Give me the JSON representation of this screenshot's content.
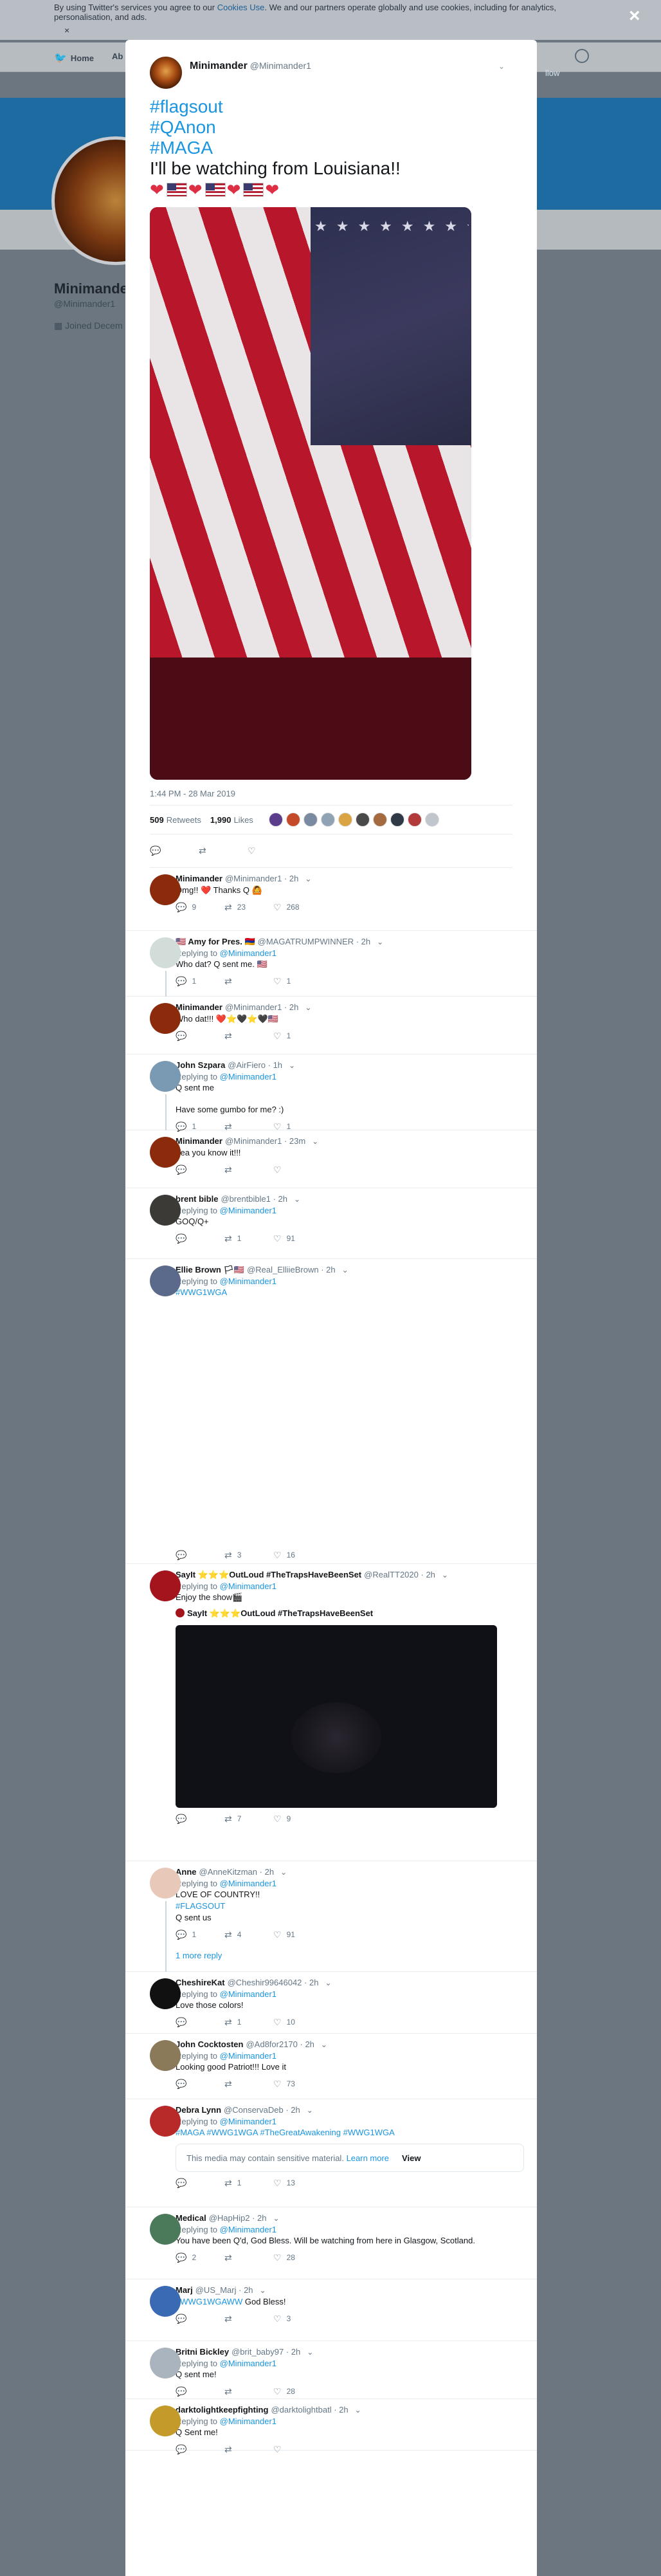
{
  "background": {
    "cookie_text_pre": "By using Twitter's services you agree to our ",
    "cookie_link": "Cookies Use",
    "cookie_text_post": ". We and our partners operate globally and use cookies, including for analytics, personalisation, and ads.",
    "nav_home": "Home",
    "nav_about": "Ab",
    "profile_name": "Minimander",
    "profile_handle": "@Minimander1",
    "profile_joined": "Joined Decem",
    "right_follow": "llow"
  },
  "modal": {
    "close_symbol": "×",
    "main_tweet": {
      "name": "Minimander",
      "handle": "@Minimander1",
      "tags": [
        "#flagsout",
        "#QAnon",
        "#MAGA"
      ],
      "text": "I'll be watching from Louisiana!!",
      "time": "1:44 PM - 28 Mar 2019",
      "retweets_count": "509",
      "retweets_label": "Retweets",
      "likes_count": "1,990",
      "likes_label": "Likes",
      "liker_colors": [
        "#5a3e8c",
        "#c44a2a",
        "#7a8aa0",
        "#8fa3b5",
        "#d9a441",
        "#4a4a4a",
        "#a36b3f",
        "#303a46",
        "#b33a3a",
        "#c0c6cc"
      ]
    },
    "replies": [
      {
        "name": "Minimander",
        "handle": "@Minimander1",
        "time": "· 2h",
        "replying": "",
        "replying_to": "",
        "text": "Omg!! ❤️ Thanks Q 🙆",
        "links": "",
        "counts": {
          "reply": "9",
          "retweet": "23",
          "like": "268"
        },
        "avatar": "#8c2a0c"
      },
      {
        "name": "🇺🇸 Amy for Pres. 🇦🇲",
        "handle": "@MAGATRUMPWINNER",
        "time": "· 2h",
        "replying": "Replying to ",
        "replying_to": "@Minimander1",
        "text": "Who dat? Q sent me. 🇺🇸",
        "links": "",
        "counts": {
          "reply": "1",
          "retweet": "",
          "like": "1"
        },
        "avatar": "#d2dcd8"
      },
      {
        "name": "Minimander",
        "handle": "@Minimander1",
        "time": "· 2h",
        "replying": "",
        "replying_to": "",
        "text": "Who dat!!! ❤️⭐🖤⭐🖤🇺🇸",
        "links": "",
        "counts": {
          "reply": "",
          "retweet": "",
          "like": "1"
        },
        "avatar": "#8c2a0c"
      },
      {
        "name": "John Szpara",
        "handle": "@AirFiero",
        "time": "· 1h",
        "replying": "Replying to ",
        "replying_to": "@Minimander1",
        "text": "Q sent me",
        "text2": "Have some gumbo for me? :)",
        "links": "",
        "counts": {
          "reply": "1",
          "retweet": "",
          "like": "1"
        },
        "avatar": "#7a9ab4"
      },
      {
        "name": "Minimander",
        "handle": "@Minimander1",
        "time": "· 23m",
        "replying": "",
        "replying_to": "",
        "text": "Yea you know it!!!",
        "links": "",
        "counts": {
          "reply": "",
          "retweet": "",
          "like": ""
        },
        "avatar": "#8c2a0c"
      },
      {
        "name": "brent bible",
        "handle": "@brentbible1",
        "time": "· 2h",
        "replying": "Replying to ",
        "replying_to": "@Minimander1",
        "text": "GOQ/Q+",
        "links": "",
        "counts": {
          "reply": "",
          "retweet": "1",
          "like": "91"
        },
        "avatar": "#3b3a36"
      },
      {
        "name": "Ellie Brown 🏳🇺🇸",
        "handle": "@Real_ElliieBrown",
        "time": "· 2h",
        "replying": "Replying to ",
        "replying_to": "@Minimander1",
        "text": "",
        "links": "#WWG1WGA",
        "counts": {
          "reply": "",
          "retweet": "3",
          "like": "16"
        },
        "avatar": "#5b6a8a"
      },
      {
        "name": "SayIt ⭐⭐⭐OutLoud #TheTrapsHaveBeenSet",
        "handle": "@RealTT2020",
        "time": "· 2h",
        "replying": "Replying to ",
        "replying_to": "@Minimander1",
        "text": "Enjoy the show🎬",
        "quote": "SayIt ⭐⭐⭐OutLoud #TheTrapsHaveBeenSet",
        "links": "",
        "counts": {
          "reply": "",
          "retweet": "7",
          "like": "9"
        },
        "avatar": "#a3141c"
      },
      {
        "name": "Anne",
        "handle": "@AnneKitzman",
        "time": "· 2h",
        "replying": "Replying to ",
        "replying_to": "@Minimander1",
        "text": "LOVE OF COUNTRY!!",
        "links": "#FLAGSOUT",
        "text3": "Q sent us",
        "more": "1 more reply",
        "counts": {
          "reply": "1",
          "retweet": "4",
          "like": "91"
        },
        "avatar": "#e8c8b8"
      },
      {
        "name": "CheshireKat",
        "handle": "@Cheshir99646042",
        "time": "· 2h",
        "replying": "Replying to ",
        "replying_to": "@Minimander1",
        "text": "Love those colors!",
        "links": "",
        "counts": {
          "reply": "",
          "retweet": "1",
          "like": "10"
        },
        "avatar": "#111111"
      },
      {
        "name": "John Cocktosten",
        "handle": "@Ad8for2170",
        "time": "· 2h",
        "replying": "Replying to ",
        "replying_to": "@Minimander1",
        "text": "Looking good Patriot!!! Love it",
        "links": "",
        "counts": {
          "reply": "",
          "retweet": "",
          "like": "73"
        },
        "avatar": "#8a7a5a"
      },
      {
        "name": "Debra Lynn",
        "handle": "@ConservaDeb",
        "time": "· 2h",
        "replying": "Replying to ",
        "replying_to": "@Minimander1",
        "text": "",
        "links": "#MAGA #WWG1WGA #TheGreatAwakening #WWG1WGA",
        "sensitive": "This media may contain sensitive material.",
        "learn_more": "Learn more",
        "view": "View",
        "counts": {
          "reply": "",
          "retweet": "1",
          "like": "13"
        },
        "avatar": "#b82a2a"
      },
      {
        "name": "Medical",
        "handle": "@HapHip2",
        "time": "· 2h",
        "replying": "Replying to ",
        "replying_to": "@Minimander1",
        "text": "You have been Q'd, God Bless. Will be watching from here in Glasgow, Scotland.",
        "links": "",
        "counts": {
          "reply": "2",
          "retweet": "",
          "like": "28"
        },
        "avatar": "#4a7a5a"
      },
      {
        "name": "Marj",
        "handle": "@US_Marj",
        "time": "· 2h",
        "replying": "",
        "replying_to": "",
        "text": " God Bless!",
        "links": "#WWG1WGAWW",
        "counts": {
          "reply": "",
          "retweet": "",
          "like": "3"
        },
        "avatar": "#3a6ab4"
      },
      {
        "name": "Britni Bickley",
        "handle": "@brit_baby97",
        "time": "· 2h",
        "replying": "Replying to ",
        "replying_to": "@Minimander1",
        "text": "Q sent me!",
        "links": "",
        "counts": {
          "reply": "",
          "retweet": "",
          "like": "28"
        },
        "avatar": "#aab4be"
      },
      {
        "name": "darktolightkeepfighting",
        "handle": "@darktolightbatl",
        "time": "· 2h",
        "replying": "Replying to ",
        "replying_to": "@Minimander1",
        "text": "Q Sent me!",
        "links": "",
        "counts": {
          "reply": "",
          "retweet": "",
          "like": ""
        },
        "avatar": "#c49a2a"
      }
    ]
  }
}
